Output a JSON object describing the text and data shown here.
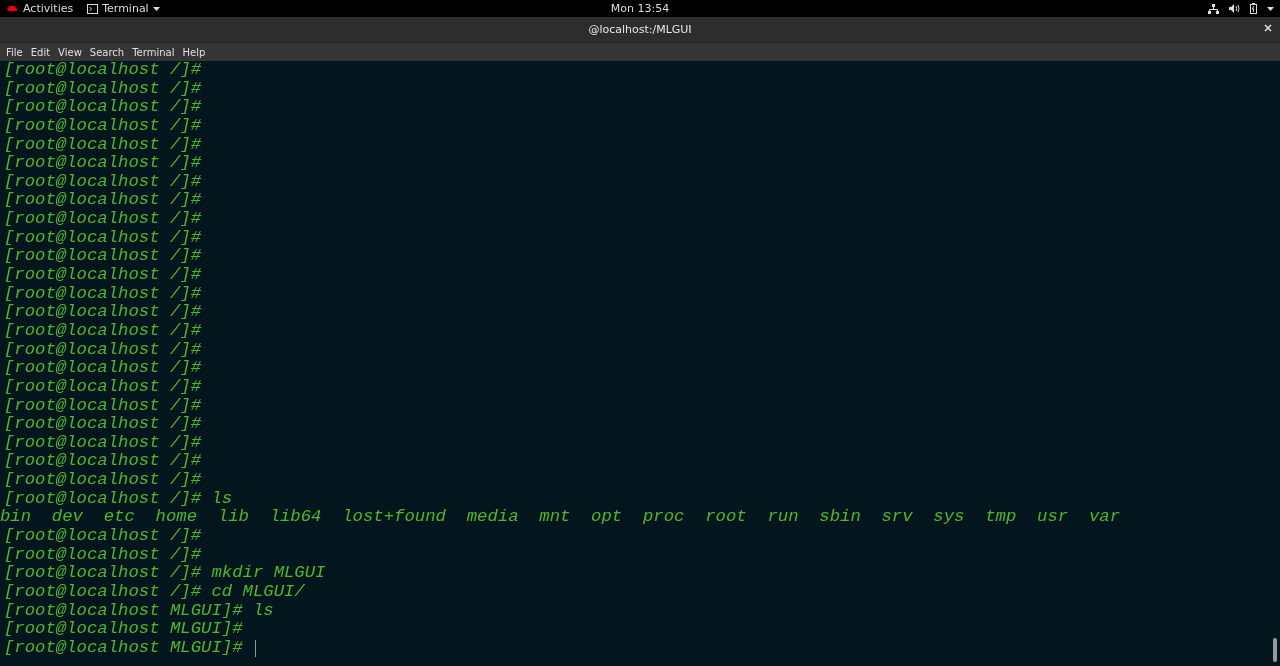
{
  "top_bar": {
    "activities": "Activities",
    "app_menu": "Terminal",
    "clock": "Mon 13:54"
  },
  "window": {
    "title": "@localhost:/MLGUI"
  },
  "menu": [
    "File",
    "Edit",
    "View",
    "Search",
    "Terminal",
    "Help"
  ],
  "terminal": {
    "lines": [
      {
        "kind": "prompt",
        "text": "[root@localhost /]#"
      },
      {
        "kind": "prompt",
        "text": "[root@localhost /]#"
      },
      {
        "kind": "prompt",
        "text": "[root@localhost /]#"
      },
      {
        "kind": "prompt",
        "text": "[root@localhost /]#"
      },
      {
        "kind": "prompt",
        "text": "[root@localhost /]#"
      },
      {
        "kind": "prompt",
        "text": "[root@localhost /]#"
      },
      {
        "kind": "prompt",
        "text": "[root@localhost /]#"
      },
      {
        "kind": "prompt",
        "text": "[root@localhost /]#"
      },
      {
        "kind": "prompt",
        "text": "[root@localhost /]#"
      },
      {
        "kind": "prompt",
        "text": "[root@localhost /]#"
      },
      {
        "kind": "prompt",
        "text": "[root@localhost /]#"
      },
      {
        "kind": "prompt",
        "text": "[root@localhost /]#"
      },
      {
        "kind": "prompt",
        "text": "[root@localhost /]#"
      },
      {
        "kind": "prompt",
        "text": "[root@localhost /]#"
      },
      {
        "kind": "prompt",
        "text": "[root@localhost /]#"
      },
      {
        "kind": "prompt",
        "text": "[root@localhost /]#"
      },
      {
        "kind": "prompt",
        "text": "[root@localhost /]#"
      },
      {
        "kind": "prompt",
        "text": "[root@localhost /]#"
      },
      {
        "kind": "prompt",
        "text": "[root@localhost /]#"
      },
      {
        "kind": "prompt",
        "text": "[root@localhost /]#"
      },
      {
        "kind": "prompt",
        "text": "[root@localhost /]#"
      },
      {
        "kind": "prompt",
        "text": "[root@localhost /]#"
      },
      {
        "kind": "prompt",
        "text": "[root@localhost /]#"
      },
      {
        "kind": "prompt",
        "text": "[root@localhost /]# ls"
      },
      {
        "kind": "output",
        "text": "bin  dev  etc  home  lib  lib64  lost+found  media  mnt  opt  proc  root  run  sbin  srv  sys  tmp  usr  var"
      },
      {
        "kind": "prompt",
        "text": "[root@localhost /]#"
      },
      {
        "kind": "prompt",
        "text": "[root@localhost /]#"
      },
      {
        "kind": "prompt",
        "text": "[root@localhost /]# mkdir MLGUI"
      },
      {
        "kind": "prompt",
        "text": "[root@localhost /]# cd MLGUI/"
      },
      {
        "kind": "prompt",
        "text": "[root@localhost MLGUI]# ls"
      },
      {
        "kind": "prompt",
        "text": "[root@localhost MLGUI]#"
      },
      {
        "kind": "cursor",
        "text": "[root@localhost MLGUI]#"
      }
    ]
  }
}
